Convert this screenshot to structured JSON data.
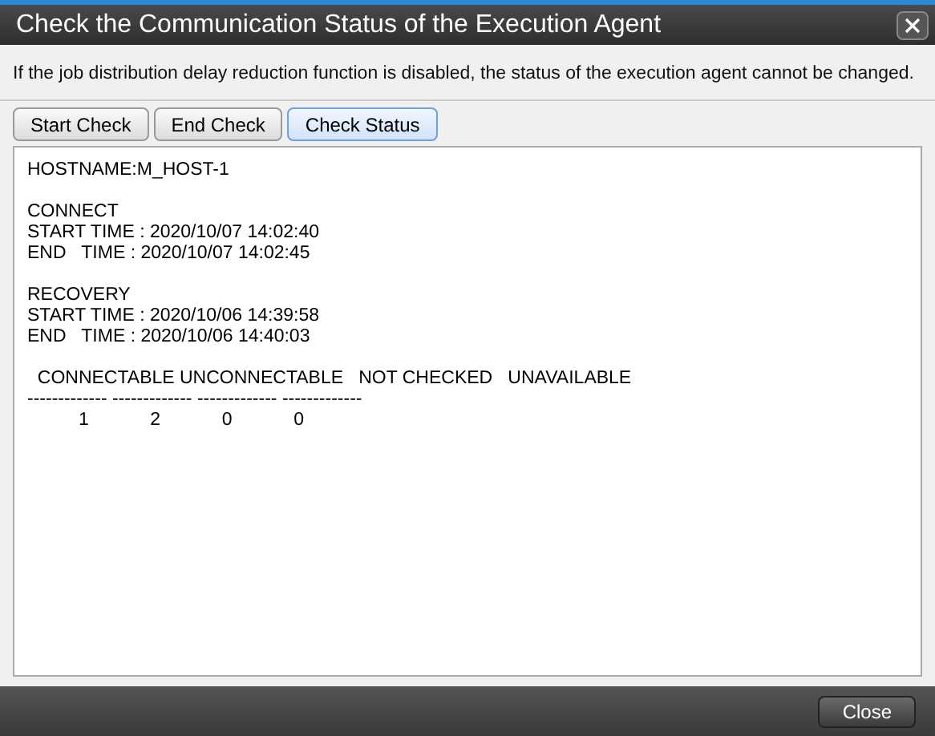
{
  "window": {
    "title": "Check the Communication Status of the Execution Agent"
  },
  "notice": "If the job distribution delay reduction function is disabled, the status of the execution agent cannot be changed.",
  "tabs": [
    {
      "label": "Start Check",
      "selected": false
    },
    {
      "label": "End Check",
      "selected": false
    },
    {
      "label": "Check Status",
      "selected": true
    }
  ],
  "output": [
    [
      "HOSTNAME:M_HOST-1"
    ],
    [
      "CONNECT",
      "START TIME : 2020/10/07 14:02:40",
      "END   TIME : 2020/10/07 14:02:45"
    ],
    [
      "RECOVERY",
      "START TIME : 2020/10/06 14:39:58",
      "END   TIME : 2020/10/06 14:40:03"
    ],
    [
      "  CONNECTABLE UNCONNECTABLE   NOT CHECKED   UNAVAILABLE",
      "------------- ------------- ------------- -------------",
      "          1            2            0            0"
    ]
  ],
  "buttons": [
    "Close"
  ]
}
